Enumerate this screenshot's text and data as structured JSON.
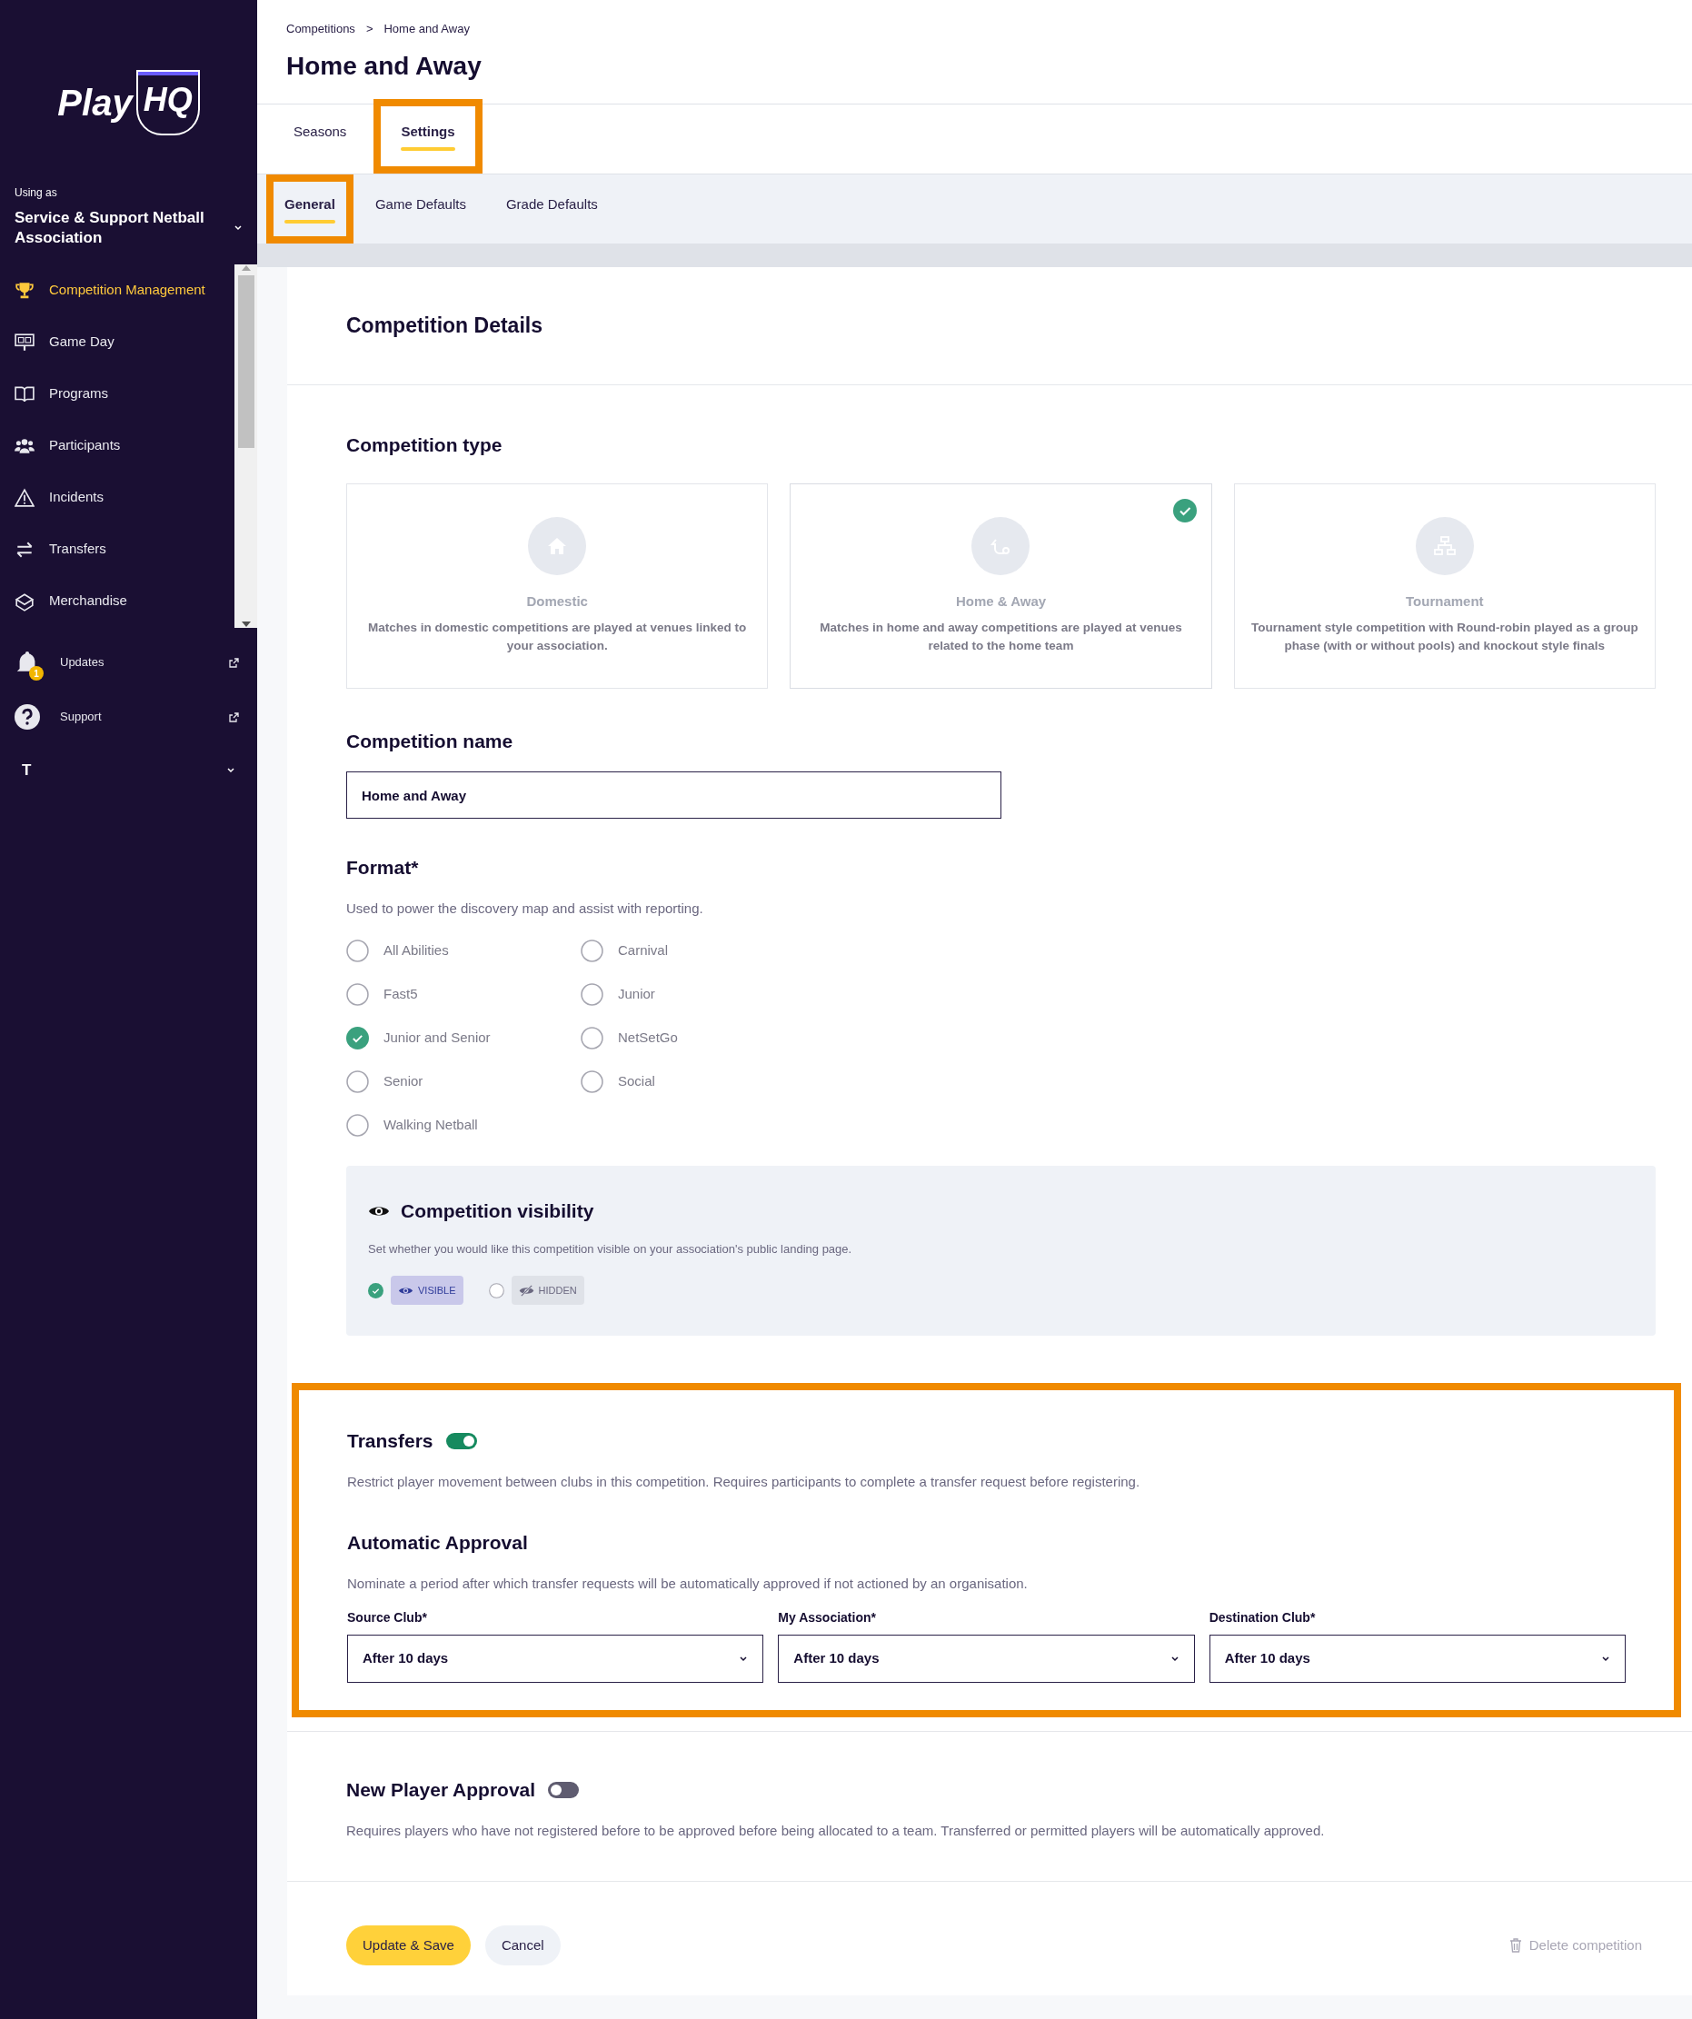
{
  "sidebar": {
    "logo": "Play",
    "logo_badge": "HQ",
    "using_as_label": "Using as",
    "organisation": "Service & Support Netball Association",
    "nav": [
      {
        "label": "Competition Management",
        "kind": "trophy",
        "selected": true
      },
      {
        "label": "Game Day",
        "kind": "scoreboard",
        "selected": false
      },
      {
        "label": "Programs",
        "kind": "book",
        "selected": false
      },
      {
        "label": "Participants",
        "kind": "people",
        "selected": false
      },
      {
        "label": "Incidents",
        "kind": "warning",
        "selected": false
      },
      {
        "label": "Transfers",
        "kind": "arrows",
        "selected": false
      },
      {
        "label": "Merchandise",
        "kind": "box",
        "selected": false
      }
    ],
    "footer_items": [
      {
        "label": "Updates",
        "kind": "bell",
        "badge": "1"
      },
      {
        "label": "Support",
        "kind": "help"
      }
    ],
    "user_initial": "T"
  },
  "breadcrumb": [
    "Competitions",
    "Home and Away"
  ],
  "breadcrumb_separator": ">",
  "title": "Home and Away",
  "tabs": [
    {
      "label": "Seasons",
      "selected": false,
      "highlighted": false
    },
    {
      "label": "Settings",
      "selected": true,
      "highlighted": true
    }
  ],
  "subtabs": [
    {
      "label": "General",
      "selected": true,
      "highlighted": true
    },
    {
      "label": "Game Defaults",
      "selected": false,
      "highlighted": false
    },
    {
      "label": "Grade Defaults",
      "selected": false,
      "highlighted": false
    }
  ],
  "details_heading": "Competition Details",
  "competition_type": {
    "heading": "Competition type",
    "options": [
      {
        "kind": "home",
        "name": "Domestic",
        "description": "Matches in domestic competitions are played at venues linked to your association.",
        "selected": false
      },
      {
        "kind": "route",
        "name": "Home & Away",
        "description": "Matches in home and away competitions are played at venues related to the home team",
        "selected": true
      },
      {
        "kind": "bracket",
        "name": "Tournament",
        "description": "Tournament style competition with Round-robin played as a group phase (with or without pools) and knockout style finals",
        "selected": false
      }
    ]
  },
  "competition_name": {
    "label": "Competition name",
    "value": "Home and Away"
  },
  "format": {
    "label": "Format*",
    "description": "Used to power the discovery map and assist with reporting.",
    "options": [
      {
        "label": "All Abilities",
        "selected": false
      },
      {
        "label": "Carnival",
        "selected": false
      },
      {
        "label": "Fast5",
        "selected": false
      },
      {
        "label": "Junior",
        "selected": false
      },
      {
        "label": "Junior and Senior",
        "selected": true
      },
      {
        "label": "NetSetGo",
        "selected": false
      },
      {
        "label": "Senior",
        "selected": false
      },
      {
        "label": "Social",
        "selected": false
      },
      {
        "label": "Walking Netball",
        "selected": false
      }
    ]
  },
  "visibility": {
    "heading": "Competition visibility",
    "description": "Set whether you would like this competition visible on your association's public landing page.",
    "options": [
      {
        "label": "VISIBLE",
        "kind": "visible",
        "selected": true
      },
      {
        "label": "HIDDEN",
        "kind": "hidden",
        "selected": false
      }
    ]
  },
  "transfers": {
    "heading": "Transfers",
    "on": true,
    "highlighted": true,
    "description": "Restrict player movement between clubs in this competition. Requires participants to complete a transfer request before registering.",
    "auto_approval": {
      "heading": "Automatic Approval",
      "description": "Nominate a period after which transfer requests will be automatically approved if not actioned by an organisation.",
      "fields": [
        {
          "label": "Source Club*",
          "value": "After 10 days"
        },
        {
          "label": "My Association*",
          "value": "After 10 days"
        },
        {
          "label": "Destination Club*",
          "value": "After 10 days"
        }
      ]
    }
  },
  "new_player_approval": {
    "heading": "New Player Approval",
    "on": false,
    "description": "Requires players who have not registered before to be approved before being allocated to a team. Transferred or permitted players will be automatically approved."
  },
  "actions": {
    "primary": "Update & Save",
    "secondary": "Cancel",
    "delete": "Delete competition"
  }
}
